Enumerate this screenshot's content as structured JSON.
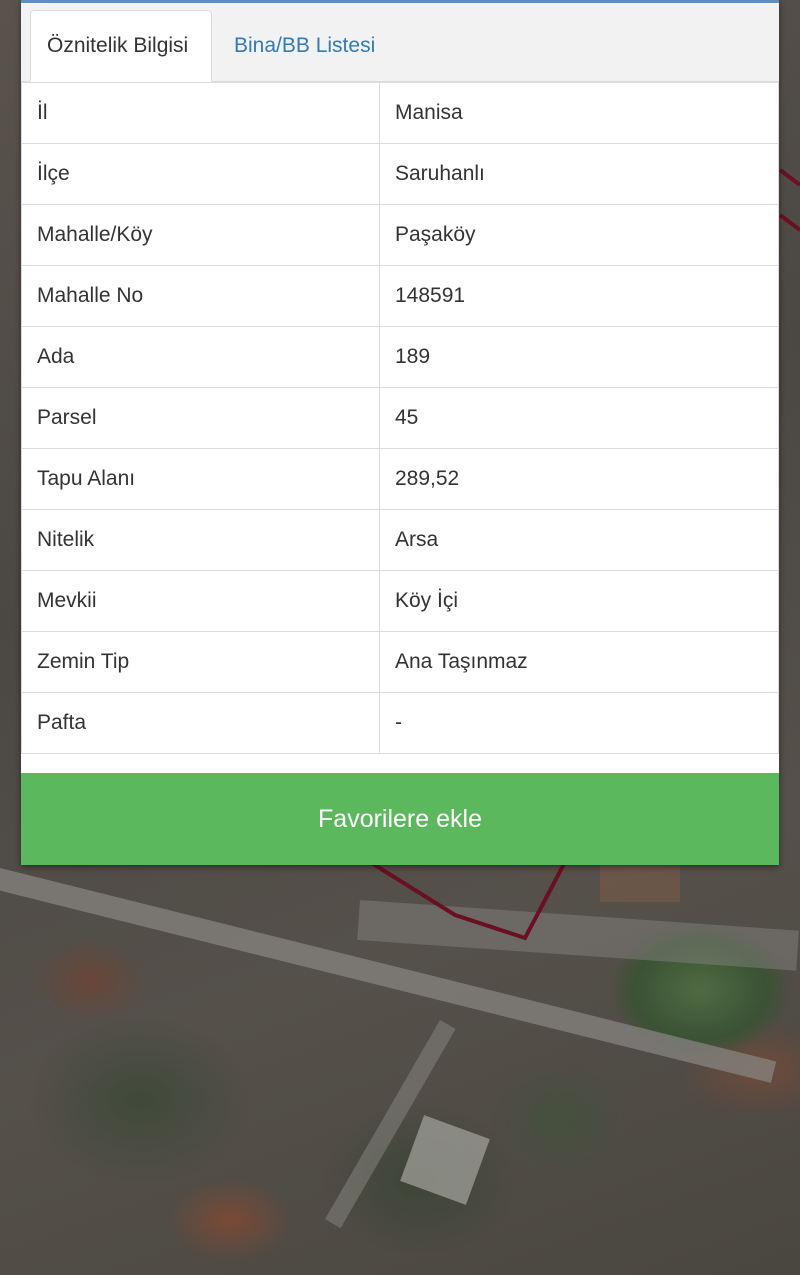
{
  "tabs": [
    {
      "label": "Öznitelik Bilgisi",
      "active": true
    },
    {
      "label": "Bina/BB Listesi",
      "active": false
    }
  ],
  "attributes": [
    {
      "key": "İl",
      "value": "Manisa"
    },
    {
      "key": "İlçe",
      "value": "Saruhanlı"
    },
    {
      "key": "Mahalle/Köy",
      "value": "Paşaköy"
    },
    {
      "key": "Mahalle No",
      "value": "148591"
    },
    {
      "key": "Ada",
      "value": "189"
    },
    {
      "key": "Parsel",
      "value": "45"
    },
    {
      "key": "Tapu Alanı",
      "value": "289,52"
    },
    {
      "key": "Nitelik",
      "value": "Arsa"
    },
    {
      "key": "Mevkii",
      "value": "Köy İçi"
    },
    {
      "key": "Zemin Tip",
      "value": "Ana Taşınmaz"
    },
    {
      "key": "Pafta",
      "value": "-"
    }
  ],
  "actions": {
    "favorite_label": "Favorilere ekle"
  },
  "colors": {
    "accent": "#337ab7",
    "button": "#5cb85c",
    "parcel_outline": "#6b0f22"
  }
}
